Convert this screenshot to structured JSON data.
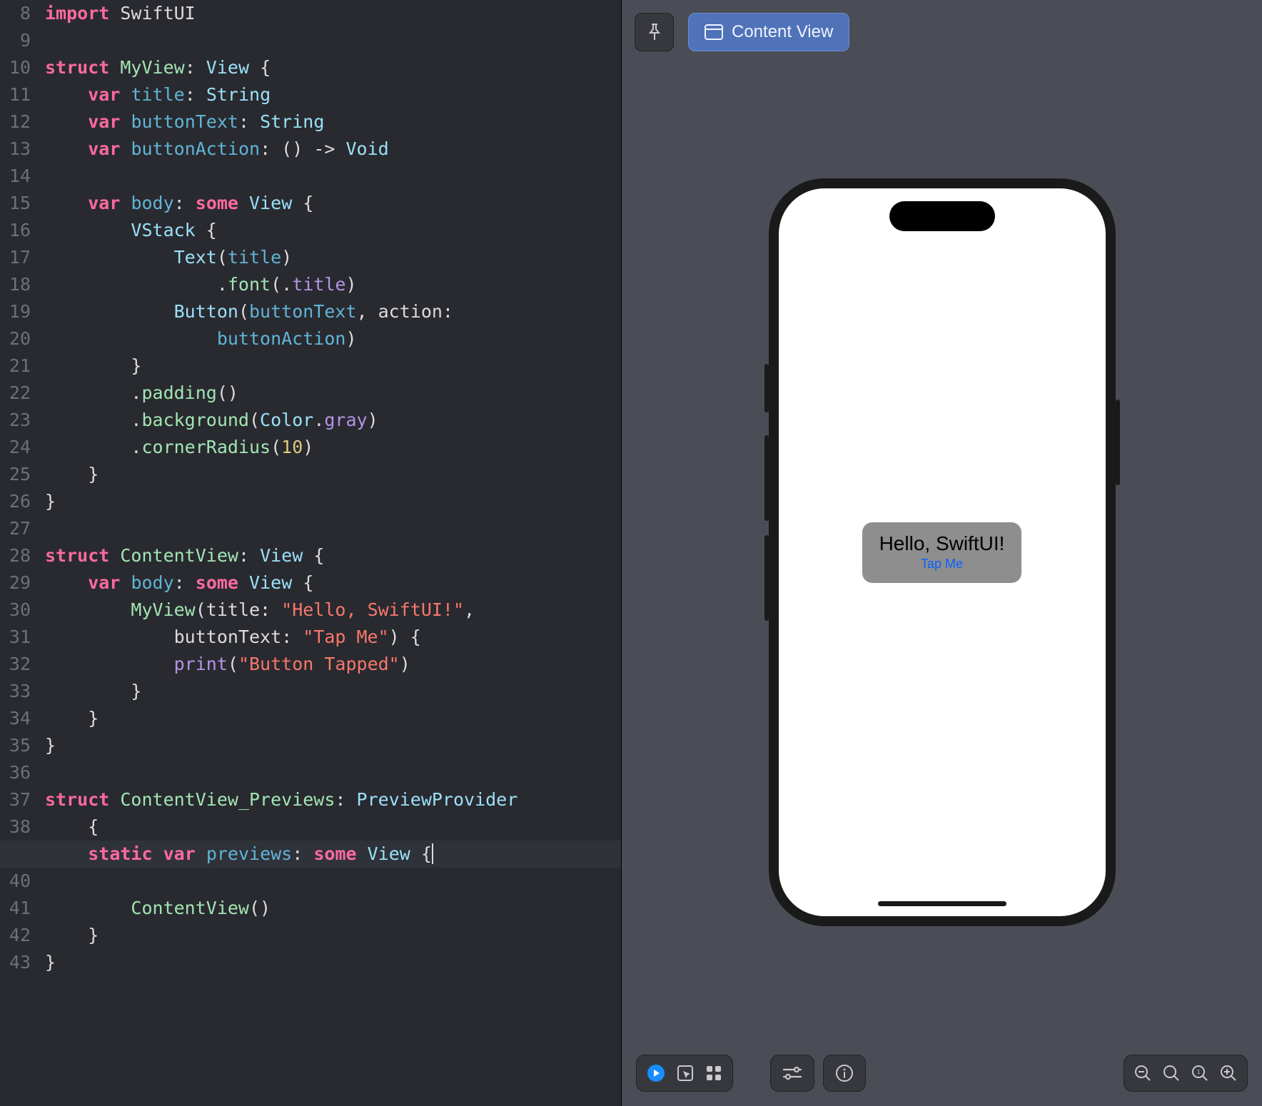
{
  "editor": {
    "first_line_number": 8,
    "lines": [
      [
        {
          "c": "kw",
          "t": "import"
        },
        {
          "c": "punc",
          "t": " "
        },
        {
          "c": "id",
          "t": "SwiftUI"
        }
      ],
      [],
      [
        {
          "c": "kw",
          "t": "struct"
        },
        {
          "c": "punc",
          "t": " "
        },
        {
          "c": "typeuser",
          "t": "MyView"
        },
        {
          "c": "punc",
          "t": ": "
        },
        {
          "c": "type",
          "t": "View"
        },
        {
          "c": "punc",
          "t": " {"
        }
      ],
      [
        {
          "c": "punc",
          "t": "    "
        },
        {
          "c": "kw",
          "t": "var"
        },
        {
          "c": "punc",
          "t": " "
        },
        {
          "c": "prop",
          "t": "title"
        },
        {
          "c": "punc",
          "t": ": "
        },
        {
          "c": "type",
          "t": "String"
        }
      ],
      [
        {
          "c": "punc",
          "t": "    "
        },
        {
          "c": "kw",
          "t": "var"
        },
        {
          "c": "punc",
          "t": " "
        },
        {
          "c": "prop",
          "t": "buttonText"
        },
        {
          "c": "punc",
          "t": ": "
        },
        {
          "c": "type",
          "t": "String"
        }
      ],
      [
        {
          "c": "punc",
          "t": "    "
        },
        {
          "c": "kw",
          "t": "var"
        },
        {
          "c": "punc",
          "t": " "
        },
        {
          "c": "prop",
          "t": "buttonAction"
        },
        {
          "c": "punc",
          "t": ": () -> "
        },
        {
          "c": "type",
          "t": "Void"
        }
      ],
      [],
      [
        {
          "c": "punc",
          "t": "    "
        },
        {
          "c": "kw",
          "t": "var"
        },
        {
          "c": "punc",
          "t": " "
        },
        {
          "c": "prop",
          "t": "body"
        },
        {
          "c": "punc",
          "t": ": "
        },
        {
          "c": "kw",
          "t": "some"
        },
        {
          "c": "punc",
          "t": " "
        },
        {
          "c": "type",
          "t": "View"
        },
        {
          "c": "punc",
          "t": " {"
        }
      ],
      [
        {
          "c": "punc",
          "t": "        "
        },
        {
          "c": "type",
          "t": "VStack"
        },
        {
          "c": "punc",
          "t": " {"
        }
      ],
      [
        {
          "c": "punc",
          "t": "            "
        },
        {
          "c": "type",
          "t": "Text"
        },
        {
          "c": "punc",
          "t": "("
        },
        {
          "c": "prop",
          "t": "title"
        },
        {
          "c": "punc",
          "t": ")"
        }
      ],
      [
        {
          "c": "punc",
          "t": "                ."
        },
        {
          "c": "method",
          "t": "font"
        },
        {
          "c": "punc",
          "t": "(."
        },
        {
          "c": "enumcase",
          "t": "title"
        },
        {
          "c": "punc",
          "t": ")"
        }
      ],
      [
        {
          "c": "punc",
          "t": "            "
        },
        {
          "c": "type",
          "t": "Button"
        },
        {
          "c": "punc",
          "t": "("
        },
        {
          "c": "prop",
          "t": "buttonText"
        },
        {
          "c": "punc",
          "t": ", action:"
        }
      ],
      [
        {
          "c": "punc",
          "t": "                "
        },
        {
          "c": "prop",
          "t": "buttonAction"
        },
        {
          "c": "punc",
          "t": ")"
        }
      ],
      [
        {
          "c": "punc",
          "t": "        }"
        }
      ],
      [
        {
          "c": "punc",
          "t": "        ."
        },
        {
          "c": "method",
          "t": "padding"
        },
        {
          "c": "punc",
          "t": "()"
        }
      ],
      [
        {
          "c": "punc",
          "t": "        ."
        },
        {
          "c": "method",
          "t": "background"
        },
        {
          "c": "punc",
          "t": "("
        },
        {
          "c": "type",
          "t": "Color"
        },
        {
          "c": "punc",
          "t": "."
        },
        {
          "c": "enumcase",
          "t": "gray"
        },
        {
          "c": "punc",
          "t": ")"
        }
      ],
      [
        {
          "c": "punc",
          "t": "        ."
        },
        {
          "c": "method",
          "t": "cornerRadius"
        },
        {
          "c": "punc",
          "t": "("
        },
        {
          "c": "num",
          "t": "10"
        },
        {
          "c": "punc",
          "t": ")"
        }
      ],
      [
        {
          "c": "punc",
          "t": "    }"
        }
      ],
      [
        {
          "c": "punc",
          "t": "}"
        }
      ],
      [],
      [
        {
          "c": "kw",
          "t": "struct"
        },
        {
          "c": "punc",
          "t": " "
        },
        {
          "c": "typeuser",
          "t": "ContentView"
        },
        {
          "c": "punc",
          "t": ": "
        },
        {
          "c": "type",
          "t": "View"
        },
        {
          "c": "punc",
          "t": " {"
        }
      ],
      [
        {
          "c": "punc",
          "t": "    "
        },
        {
          "c": "kw",
          "t": "var"
        },
        {
          "c": "punc",
          "t": " "
        },
        {
          "c": "prop",
          "t": "body"
        },
        {
          "c": "punc",
          "t": ": "
        },
        {
          "c": "kw",
          "t": "some"
        },
        {
          "c": "punc",
          "t": " "
        },
        {
          "c": "type",
          "t": "View"
        },
        {
          "c": "punc",
          "t": " {"
        }
      ],
      [
        {
          "c": "punc",
          "t": "        "
        },
        {
          "c": "typeuser",
          "t": "MyView"
        },
        {
          "c": "punc",
          "t": "(title: "
        },
        {
          "c": "str",
          "t": "\"Hello, SwiftUI!\""
        },
        {
          "c": "punc",
          "t": ","
        }
      ],
      [
        {
          "c": "punc",
          "t": "            buttonText: "
        },
        {
          "c": "str",
          "t": "\"Tap Me\""
        },
        {
          "c": "punc",
          "t": ") {"
        }
      ],
      [
        {
          "c": "punc",
          "t": "            "
        },
        {
          "c": "builtin",
          "t": "print"
        },
        {
          "c": "punc",
          "t": "("
        },
        {
          "c": "str",
          "t": "\"Button Tapped\""
        },
        {
          "c": "punc",
          "t": ")"
        }
      ],
      [
        {
          "c": "punc",
          "t": "        }"
        }
      ],
      [
        {
          "c": "punc",
          "t": "    }"
        }
      ],
      [
        {
          "c": "punc",
          "t": "}"
        }
      ],
      [],
      [
        {
          "c": "kw",
          "t": "struct"
        },
        {
          "c": "punc",
          "t": " "
        },
        {
          "c": "typeuser",
          "t": "ContentView_Previews"
        },
        {
          "c": "punc",
          "t": ": "
        },
        {
          "c": "type",
          "t": "PreviewProvider"
        }
      ],
      [
        {
          "c": "punc",
          "t": "    {"
        }
      ],
      [
        {
          "c": "punc",
          "t": "    "
        },
        {
          "c": "kw",
          "t": "static"
        },
        {
          "c": "punc",
          "t": " "
        },
        {
          "c": "kw",
          "t": "var"
        },
        {
          "c": "punc",
          "t": " "
        },
        {
          "c": "prop",
          "t": "previews"
        },
        {
          "c": "punc",
          "t": ": "
        },
        {
          "c": "kw",
          "t": "some"
        },
        {
          "c": "punc",
          "t": " "
        },
        {
          "c": "type",
          "t": "View"
        },
        {
          "c": "punc",
          "t": " {"
        }
      ],
      [
        {
          "c": "punc",
          "t": "        "
        },
        {
          "c": "typeuser",
          "t": "ContentView"
        },
        {
          "c": "punc",
          "t": "()"
        }
      ],
      [
        {
          "c": "punc",
          "t": "    }"
        }
      ],
      [
        {
          "c": "punc",
          "t": "}"
        }
      ],
      []
    ],
    "highlight_line_index": 31
  },
  "preview": {
    "selector_label": "Content View",
    "card_title": "Hello, SwiftUI!",
    "card_button": "Tap Me"
  }
}
